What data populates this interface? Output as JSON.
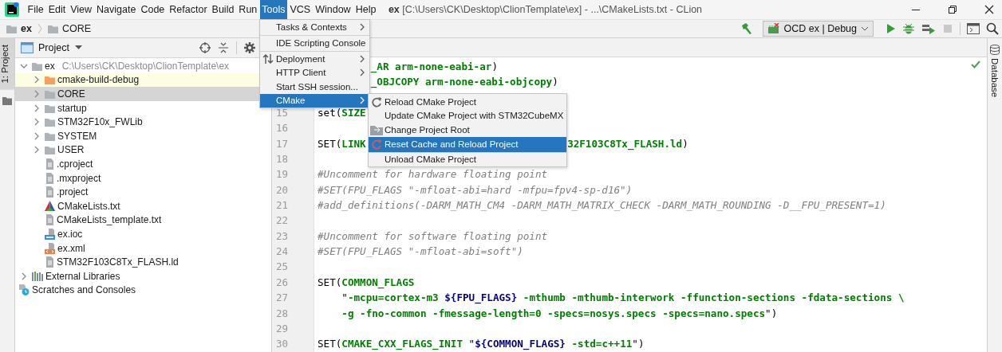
{
  "menu_bar": {
    "items": [
      {
        "label": "File",
        "selected": false
      },
      {
        "label": "Edit",
        "selected": false
      },
      {
        "label": "View",
        "selected": false
      },
      {
        "label": "Navigate",
        "selected": false
      },
      {
        "label": "Code",
        "selected": false
      },
      {
        "label": "Refactor",
        "selected": false
      },
      {
        "label": "Build",
        "selected": false
      },
      {
        "label": "Run",
        "selected": false
      },
      {
        "label": "Tools",
        "selected": true
      },
      {
        "label": "VCS",
        "selected": false
      },
      {
        "label": "Window",
        "selected": false
      },
      {
        "label": "Help",
        "selected": false
      }
    ],
    "window_title": "**ex** [C:\\Users\\CK\\Desktop\\ClionTemplate\\ex] - ...\\CMakeLists.txt - CLion"
  },
  "navigation_bar": {
    "breadcrumbs": [
      "ex",
      "CORE"
    ],
    "run_configuration": "OCD ex | Debug"
  },
  "left_stripe": {
    "label": "1: Project",
    "selected": true
  },
  "project_panel": {
    "title": "Project",
    "tree": [
      {
        "label": "ex",
        "path": "C:\\Users\\CK\\Desktop\\ClionTemplate\\ex",
        "kind": "folder",
        "expanded": true,
        "selected": false,
        "highlighted": false,
        "children": [
          {
            "label": "cmake-build-debug",
            "kind": "excluded",
            "expanded": false,
            "selected": false,
            "highlighted": true
          },
          {
            "label": "CORE",
            "kind": "folder",
            "expanded": false,
            "selected": true,
            "highlighted": false
          },
          {
            "label": "startup",
            "kind": "folder",
            "expanded": false,
            "selected": false,
            "highlighted": false
          },
          {
            "label": "STM32F10x_FWLib",
            "kind": "folder",
            "expanded": false,
            "selected": false,
            "highlighted": false
          },
          {
            "label": "SYSTEM",
            "kind": "folder",
            "expanded": false,
            "selected": false,
            "highlighted": false
          },
          {
            "label": "USER",
            "kind": "folder",
            "expanded": false,
            "selected": false,
            "highlighted": false
          },
          {
            "label": ".cproject",
            "kind": "file",
            "selected": false,
            "highlighted": false
          },
          {
            "label": ".mxproject",
            "kind": "file",
            "selected": false,
            "highlighted": false
          },
          {
            "label": ".project",
            "kind": "file",
            "selected": false,
            "highlighted": false
          },
          {
            "label": "CMakeLists.txt",
            "kind": "cmake",
            "selected": false,
            "highlighted": false
          },
          {
            "label": "CMakeLists_template.txt",
            "kind": "file",
            "selected": false,
            "highlighted": false
          },
          {
            "label": "ex.ioc",
            "kind": "ioc",
            "selected": false,
            "highlighted": false
          },
          {
            "label": "ex.xml",
            "kind": "xml",
            "selected": false,
            "highlighted": false
          },
          {
            "label": "STM32F103C8Tx_FLASH.ld",
            "kind": "file",
            "selected": false,
            "highlighted": false
          }
        ]
      },
      {
        "label": "External Libraries",
        "kind": "libraries",
        "expanded": false,
        "selected": false,
        "highlighted": false
      },
      {
        "label": "Scratches and Consoles",
        "kind": "scratches",
        "selected": false,
        "highlighted": false
      }
    ]
  },
  "editor": {
    "lines": [
      {
        "segments": [
          {
            "kind": "tail",
            "tokens": [
              {
                "text": "_AR arm-none-eabi-ar",
                "kind": "keyword"
              },
              {
                "text": ")",
                "kind": "plain"
              }
            ]
          }
        ]
      },
      {
        "segments": [
          {
            "kind": "tail",
            "tokens": [
              {
                "text": "_OBJCOPY arm-none-eabi-objcopy",
                "kind": "keyword"
              },
              {
                "text": ")",
                "kind": "plain"
              }
            ]
          }
        ]
      },
      {
        "number": "15",
        "segments": [
          {
            "kind": "lead",
            "tokens": [
              {
                "text": "set(",
                "kind": "plain"
              },
              {
                "text": "SIZE",
                "kind": "keyword"
              }
            ]
          }
        ]
      },
      {
        "number": "16"
      },
      {
        "number": "17",
        "segments": [
          {
            "kind": "lead",
            "tokens": [
              {
                "text": "SET(",
                "kind": "plain"
              },
              {
                "text": "LINK",
                "kind": "keyword"
              }
            ]
          },
          {
            "kind": "end",
            "tokens": [
              {
                "text": "32F103C8Tx_FLASH.ld",
                "kind": "keyword"
              },
              {
                "text": ")",
                "kind": "plain"
              }
            ]
          }
        ]
      },
      {
        "number": "18"
      },
      {
        "number": "19",
        "segments": [
          {
            "kind": "lead",
            "tokens": [
              {
                "text": "#Uncomment for hardware floating point",
                "kind": "comment"
              }
            ]
          }
        ]
      },
      {
        "number": "20",
        "segments": [
          {
            "kind": "lead",
            "tokens": [
              {
                "text": "#SET(FPU_FLAGS \"-mfloat-abi=hard -mfpu=fpv4-sp-d16\")",
                "kind": "comment"
              }
            ]
          }
        ]
      },
      {
        "number": "21",
        "segments": [
          {
            "kind": "lead",
            "tokens": [
              {
                "text": "#add_definitions(-DARM_MATH_CM4 -DARM_MATH_MATRIX_CHECK -DARM_MATH_ROUNDING -D__FPU_PRESENT=1)",
                "kind": "comment"
              }
            ]
          }
        ]
      },
      {
        "number": "22"
      },
      {
        "number": "23",
        "segments": [
          {
            "kind": "lead",
            "tokens": [
              {
                "text": "#Uncomment for software floating point",
                "kind": "comment"
              }
            ]
          }
        ]
      },
      {
        "number": "24",
        "segments": [
          {
            "kind": "lead",
            "tokens": [
              {
                "text": "#SET(FPU_FLAGS \"-mfloat-abi=soft\")",
                "kind": "comment"
              }
            ]
          }
        ]
      },
      {
        "number": "25"
      },
      {
        "number": "26",
        "segments": [
          {
            "kind": "lead",
            "tokens": [
              {
                "text": "SET(",
                "kind": "plain"
              },
              {
                "text": "COMMON_FLAGS",
                "kind": "keyword"
              }
            ]
          }
        ]
      },
      {
        "number": "27",
        "segments": [
          {
            "kind": "lead",
            "tokens": [
              {
                "text": "    \"",
                "kind": "plain"
              },
              {
                "text": "-mcpu=cortex-m3 ",
                "kind": "keyword"
              },
              {
                "text": "${FPU_FLAGS}",
                "kind": "variable"
              },
              {
                "text": " -mthumb -mthumb-interwork -ffunction-sections -fdata-sections \\",
                "kind": "keyword"
              }
            ]
          }
        ]
      },
      {
        "number": "28",
        "segments": [
          {
            "kind": "lead",
            "tokens": [
              {
                "text": "    -g -fno-common -fmessage-length=0 -specs=nosys.specs -specs=nano.specs",
                "kind": "keyword"
              },
              {
                "text": "\")",
                "kind": "plain"
              }
            ]
          }
        ]
      },
      {
        "number": "29"
      },
      {
        "number": "30",
        "segments": [
          {
            "kind": "lead",
            "tokens": [
              {
                "text": "SET(",
                "kind": "plain"
              },
              {
                "text": "CMAKE_CXX_FLAGS_INIT",
                "kind": "keyword"
              },
              {
                "text": " \"",
                "kind": "plain"
              },
              {
                "text": "${COMMON_FLAGS}",
                "kind": "variable"
              },
              {
                "text": " -std=c++11",
                "kind": "keyword"
              },
              {
                "text": "\")",
                "kind": "plain"
              }
            ]
          }
        ]
      }
    ]
  },
  "right_stripe": {
    "label": "Database"
  },
  "tools_menu": {
    "items": [
      {
        "label": "Tasks & Contexts",
        "kind": "plain",
        "submenu": true,
        "selected": false,
        "separator_after": true
      },
      {
        "label": "IDE Scripting Console",
        "kind": "plain",
        "submenu": false,
        "selected": false,
        "separator_after": true
      },
      {
        "label": "Deployment",
        "kind": "transfer",
        "submenu": true,
        "selected": false,
        "separator_after": false
      },
      {
        "label": "HTTP Client",
        "kind": "plain",
        "submenu": true,
        "selected": false,
        "separator_after": false
      },
      {
        "label": "Start SSH session...",
        "kind": "plain",
        "submenu": false,
        "selected": false,
        "separator_after": false
      },
      {
        "label": "CMake",
        "kind": "plain",
        "submenu": true,
        "selected": true,
        "separator_after": false
      }
    ]
  },
  "cmake_submenu": {
    "items": [
      {
        "label": "Reload CMake Project",
        "kind": "reload",
        "selected": false,
        "separator_after": false
      },
      {
        "label": "Update CMake Project with STM32CubeMX",
        "kind": "plain",
        "selected": false,
        "separator_after": false
      },
      {
        "label": "Change Project Root",
        "kind": "root",
        "selected": false,
        "separator_after": false
      },
      {
        "label": "Reset Cache and Reload Project",
        "kind": "reset",
        "selected": true,
        "separator_after": true
      },
      {
        "label": "Unload CMake Project",
        "kind": "plain",
        "selected": false,
        "separator_after": false
      }
    ]
  }
}
